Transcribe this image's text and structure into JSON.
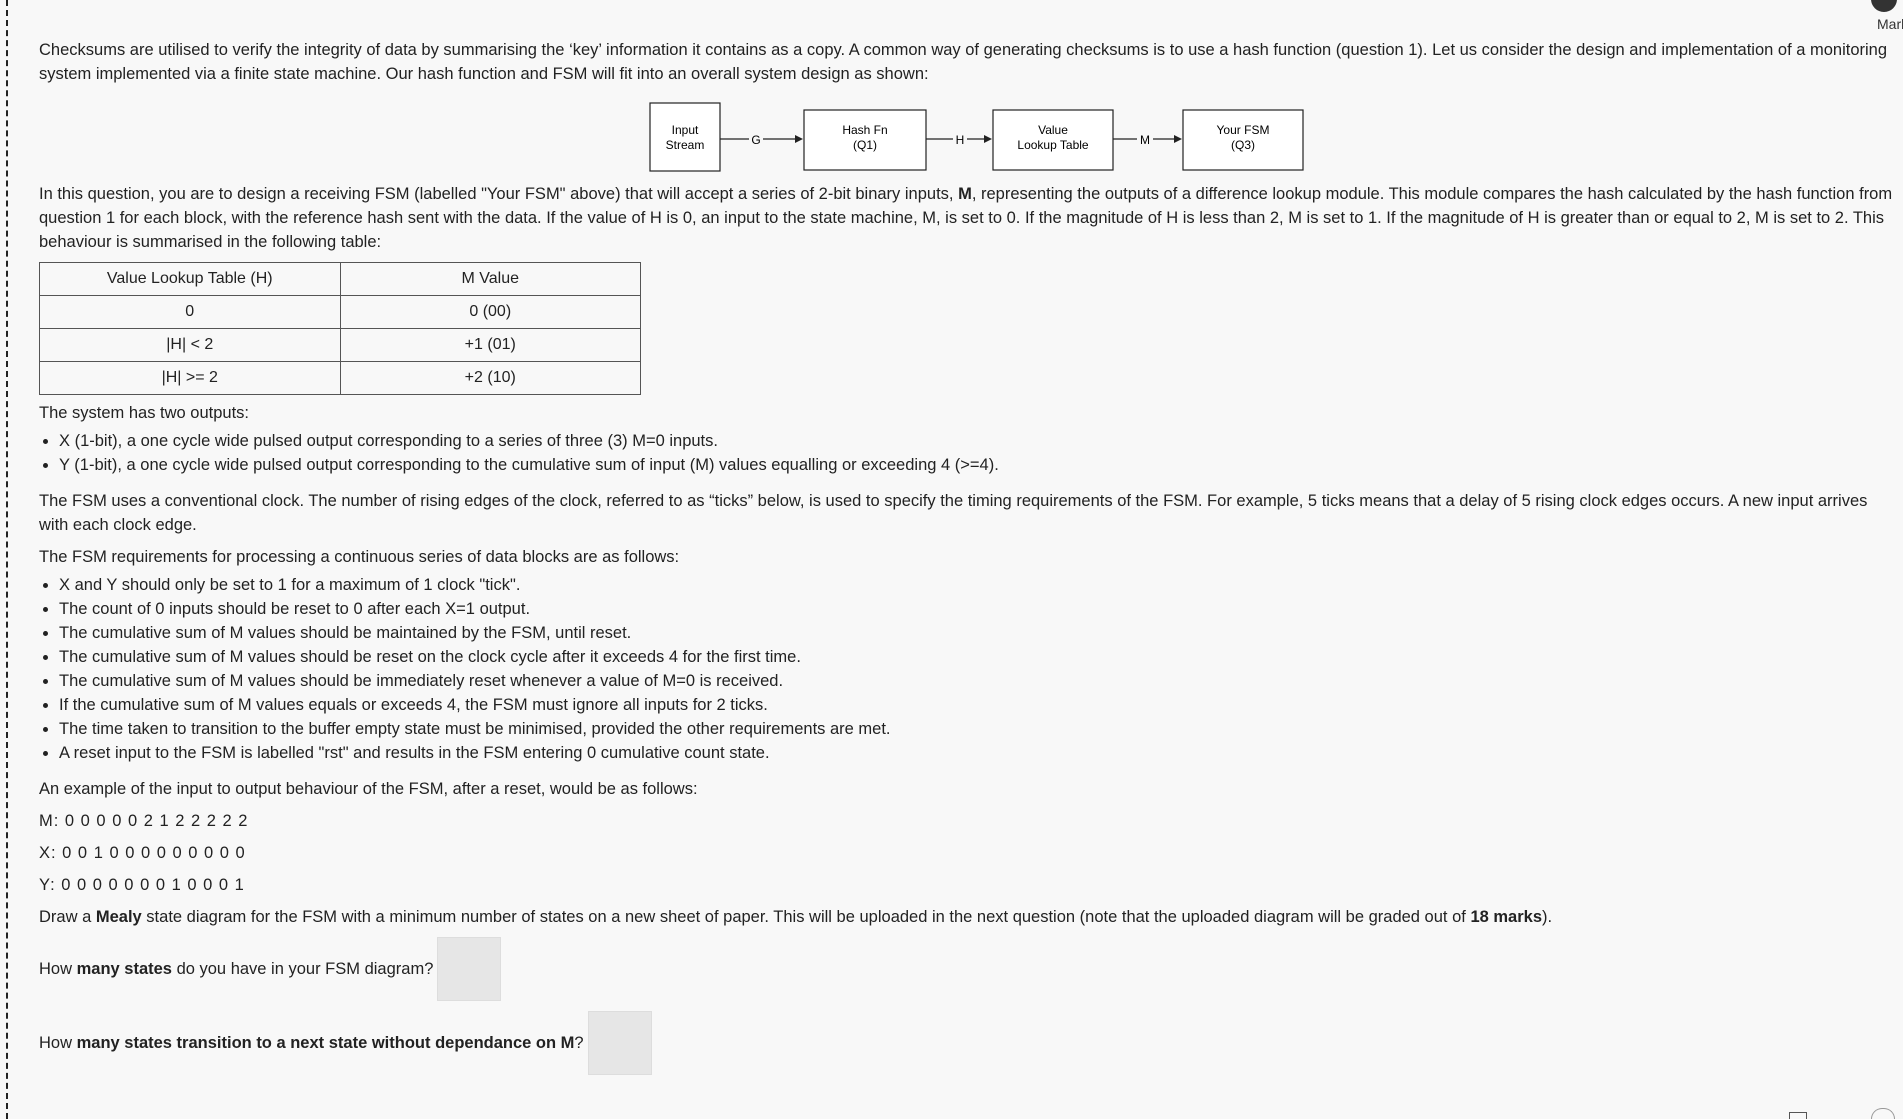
{
  "header": {
    "marks_label": "Mark"
  },
  "intro": "Checksums are utilised to verify the integrity of data by summarising the ‘key’ information it contains as a copy. A common way of generating checksums is to use a hash function (question 1). Let us consider the design and implementation of a monitoring system implemented via a finite state machine. Our hash function and FSM will fit into an overall system design as shown:",
  "diagram": {
    "blocks": [
      {
        "line1": "Input",
        "line2": "Stream"
      },
      {
        "line1": "Hash Fn",
        "line2": "(Q1)"
      },
      {
        "line1": "Value",
        "line2": "Lookup Table"
      },
      {
        "line1": "Your FSM",
        "line2": "(Q3)"
      }
    ],
    "arrows": [
      "G",
      "H",
      "M"
    ]
  },
  "question_intro": {
    "before_bold": "In this question, you are to design a receiving FSM (labelled \"Your FSM\" above) that will accept a series of 2-bit binary inputs, ",
    "bold": "M",
    "after_bold": ", representing the outputs of a difference lookup module. This module compares the hash calculated by the hash function from question 1 for each block, with the reference hash sent with the data. If the value of H is 0, an input to the state machine, M, is set to 0. If the magnitude of H is less than 2, M is set to 1. If the magnitude of H is greater than or equal to 2, M is set to 2. This behaviour is summarised in the following table:"
  },
  "table": {
    "headers": [
      "Value Lookup Table (H)",
      "M Value"
    ],
    "rows": [
      [
        "0",
        "0 (00)"
      ],
      [
        "|H| < 2",
        "+1 (01)"
      ],
      [
        "|H| >= 2",
        "+2 (10)"
      ]
    ]
  },
  "outputs_heading": "The system has two outputs:",
  "outputs": [
    "X (1-bit), a one cycle wide pulsed output corresponding to a series of three (3) M=0 inputs.",
    "Y (1-bit), a one cycle wide pulsed output corresponding to the cumulative sum of input (M) values equalling or exceeding 4 (>=4)."
  ],
  "clock_text": "The FSM uses a conventional clock. The number of rising edges of the clock, referred to as “ticks” below, is used to specify the timing requirements of the FSM. For example, 5 ticks means that a delay of 5 rising clock edges occurs. A new input arrives with each clock edge.",
  "requirements_heading": "The FSM requirements for processing a continuous series of data blocks are as follows:",
  "requirements": [
    "X and Y should only be set to 1 for a maximum of 1 clock \"tick\".",
    "The count of 0 inputs should be reset to 0 after each X=1 output.",
    "The cumulative sum of M values should be maintained by the FSM, until reset.",
    "The cumulative sum of M values should be reset on the clock cycle after it exceeds 4 for the first time.",
    "The cumulative sum of M values should be immediately reset whenever a value of M=0 is received.",
    "If the cumulative sum of M values equals or exceeds 4, the FSM must ignore all inputs for 2 ticks.",
    "The time taken to transition to the buffer empty state must be minimised, provided the other requirements are met.",
    "A reset input to the FSM is labelled \"rst\" and results in the FSM entering 0 cumulative count state."
  ],
  "example_heading": "An example of the input to output behaviour of the FSM, after a reset, would be as follows:",
  "example": {
    "m": "M: 0 0 0 0 0 2 1 2 2 2 2 2",
    "x": "X: 0 0 1 0 0 0 0 0 0 0 0 0",
    "y": "Y: 0 0 0 0 0 0 0 1 0 0 0 1"
  },
  "draw": {
    "t1": "Draw a ",
    "b1": "Mealy",
    "t2": " state diagram for the FSM with a minimum number of states on a new sheet of paper. This will be uploaded in the next question (note that the uploaded diagram will be graded out of ",
    "b2": "18 marks",
    "t3": ")."
  },
  "q1": {
    "t1": "How ",
    "b1": "many states",
    "t2": " do you have in your FSM diagram?"
  },
  "q2": {
    "t1": "How ",
    "b1": "many states transition to a next state without dependance on M",
    "t2": "?"
  }
}
